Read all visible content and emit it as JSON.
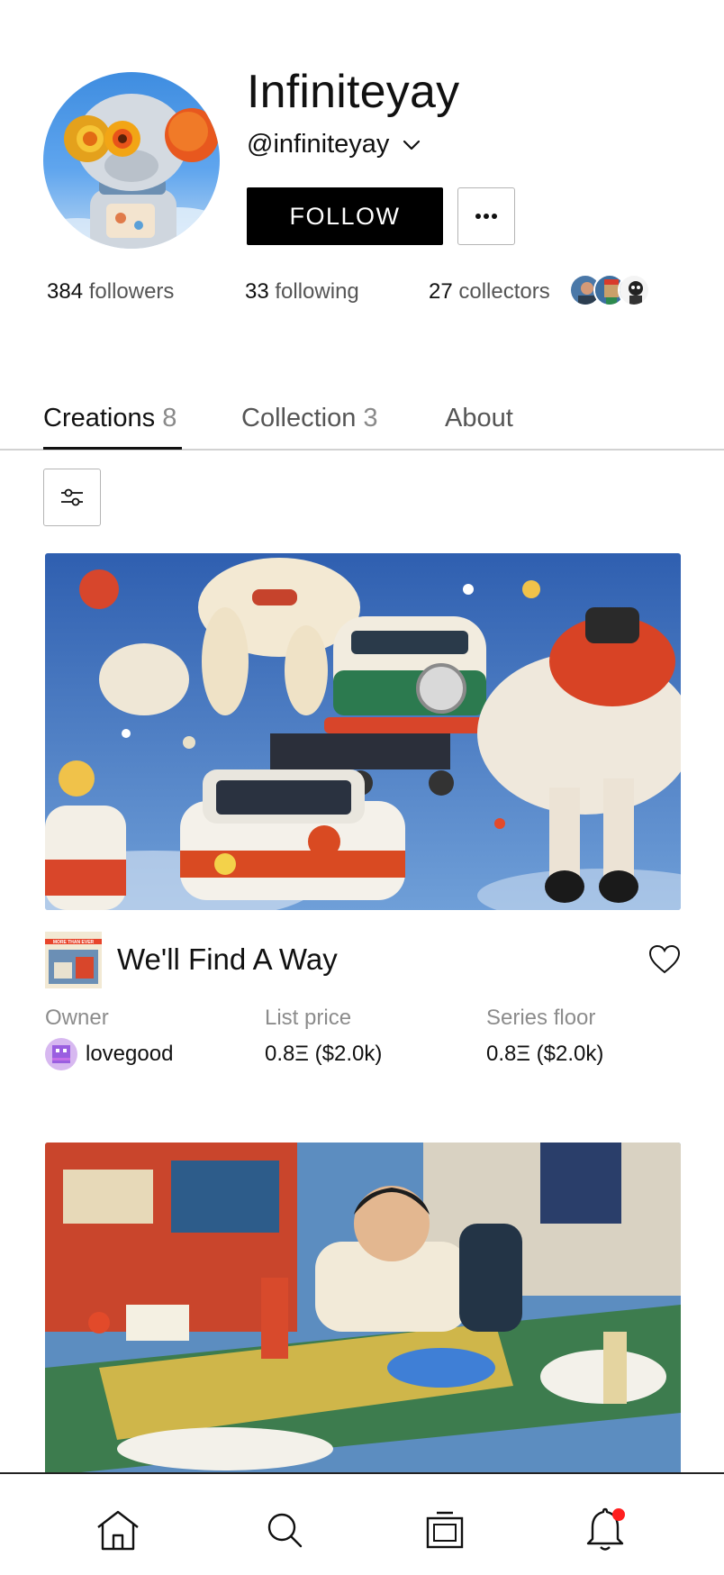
{
  "profile": {
    "display_name": "Infiniteyay",
    "handle": "@infiniteyay",
    "follow_label": "FOLLOW",
    "avatar_icon": "robot-figure-avatar"
  },
  "stats": {
    "followers_count": "384",
    "followers_label": "followers",
    "following_count": "33",
    "following_label": "following",
    "collectors_count": "27",
    "collectors_label": "collectors"
  },
  "tabs": [
    {
      "label": "Creations",
      "count": "8",
      "active": true
    },
    {
      "label": "Collection",
      "count": "3",
      "active": false
    },
    {
      "label": "About",
      "count": "",
      "active": false
    }
  ],
  "artwork": {
    "title": "We'll Find A Way",
    "thumb_text": "MORE THAN EVER",
    "owner_label": "Owner",
    "owner_name": "lovegood",
    "list_price_label": "List price",
    "list_price_value": "0.8Ξ ($2.0k)",
    "series_floor_label": "Series floor",
    "series_floor_value": "0.8Ξ ($2.0k)"
  },
  "nav": {
    "items": [
      "home-icon",
      "search-icon",
      "gallery-icon",
      "bell-icon"
    ],
    "notification_dot_color": "#ff1f1f"
  },
  "colors": {
    "primary_button": "#000000",
    "muted_text": "#8c8c8c",
    "accent_red": "#ff1f1f"
  }
}
